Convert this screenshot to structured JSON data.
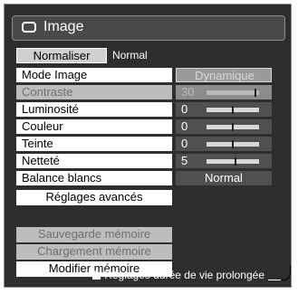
{
  "title": "Image",
  "normalize": {
    "button_label": "Normaliser",
    "value": "Normal"
  },
  "settings": [
    {
      "label": "Mode Image",
      "value": "Dynamique",
      "type": "option",
      "dimmed": false,
      "highlighted": true
    },
    {
      "label": "Contraste",
      "value": "30",
      "type": "slider",
      "level": 0.95,
      "dimmed": true
    },
    {
      "label": "Luminosité",
      "value": "0",
      "type": "slider",
      "level": 0.5,
      "dimmed": false
    },
    {
      "label": "Couleur",
      "value": "0",
      "type": "slider",
      "level": 0.5,
      "dimmed": false
    },
    {
      "label": "Teinte",
      "value": "0",
      "type": "slider",
      "level": 0.5,
      "dimmed": false
    },
    {
      "label": "Netteté",
      "value": "5",
      "type": "slider",
      "level": 0.55,
      "dimmed": false
    },
    {
      "label": "Balance blancs",
      "value": "Normal",
      "type": "option",
      "dimmed": false
    }
  ],
  "advanced_label": "Réglages avancés",
  "memory": [
    {
      "label": "Sauvegarde mémoire",
      "dimmed": true
    },
    {
      "label": "Chargement mémoire",
      "dimmed": true
    },
    {
      "label": "Modifier mémoire",
      "dimmed": false
    }
  ],
  "footer_note": "Réglages durée de vie prolongée",
  "colors": {
    "panel": "#2e2e2e",
    "row_white": "#ffffff",
    "row_dimmed": "#bdbdbd",
    "value_box": "#505050"
  }
}
